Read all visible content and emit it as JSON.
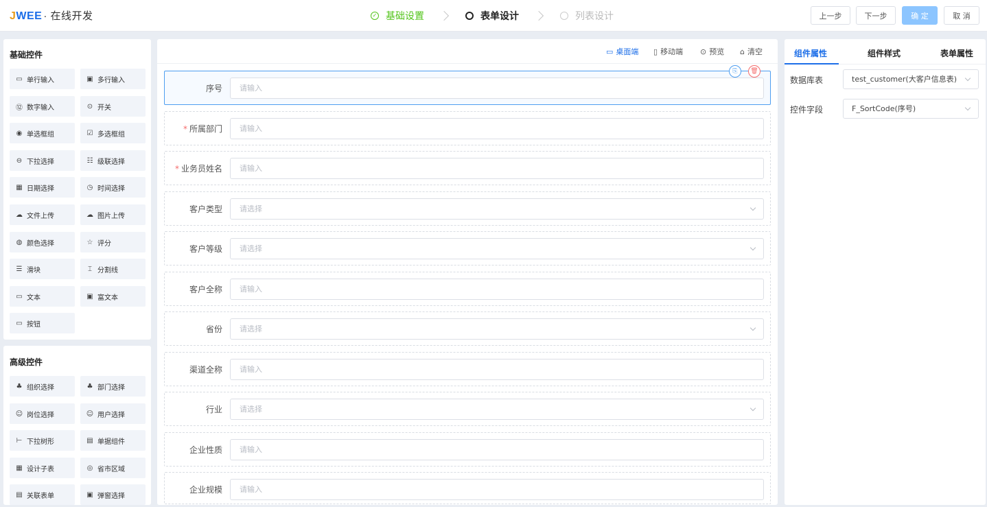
{
  "header": {
    "logo_j": "J",
    "logo_wee": "WEE",
    "logo_sub": "· 在线开发",
    "steps": [
      {
        "label": "基础设置",
        "state": "done"
      },
      {
        "label": "表单设计",
        "state": "active"
      },
      {
        "label": "列表设计",
        "state": "todo"
      }
    ],
    "buttons": {
      "prev": "上一步",
      "next": "下一步",
      "confirm": "确 定",
      "cancel": "取 消"
    }
  },
  "basic": {
    "title": "基础控件",
    "items": [
      {
        "label": "单行输入",
        "icon": "input-icon"
      },
      {
        "label": "多行输入",
        "icon": "textarea-icon"
      },
      {
        "label": "数字输入",
        "icon": "number-icon"
      },
      {
        "label": "开关",
        "icon": "switch-icon"
      },
      {
        "label": "单选框组",
        "icon": "radio-icon"
      },
      {
        "label": "多选框组",
        "icon": "checkbox-icon"
      },
      {
        "label": "下拉选择",
        "icon": "select-icon"
      },
      {
        "label": "级联选择",
        "icon": "cascader-icon"
      },
      {
        "label": "日期选择",
        "icon": "calendar-icon"
      },
      {
        "label": "时间选择",
        "icon": "clock-icon"
      },
      {
        "label": "文件上传",
        "icon": "upload-icon"
      },
      {
        "label": "图片上传",
        "icon": "image-upload-icon"
      },
      {
        "label": "颜色选择",
        "icon": "palette-icon"
      },
      {
        "label": "评分",
        "icon": "star-icon"
      },
      {
        "label": "滑块",
        "icon": "slider-icon"
      },
      {
        "label": "分割线",
        "icon": "divider-icon"
      },
      {
        "label": "文本",
        "icon": "text-icon"
      },
      {
        "label": "富文本",
        "icon": "rich-text-icon"
      },
      {
        "label": "按钮",
        "icon": "button-icon"
      }
    ]
  },
  "advanced": {
    "title": "高级控件",
    "items": [
      {
        "label": "组织选择",
        "icon": "org-icon"
      },
      {
        "label": "部门选择",
        "icon": "dept-icon"
      },
      {
        "label": "岗位选择",
        "icon": "position-icon"
      },
      {
        "label": "用户选择",
        "icon": "user-icon"
      },
      {
        "label": "下拉树形",
        "icon": "tree-icon"
      },
      {
        "label": "单据组件",
        "icon": "bill-icon"
      },
      {
        "label": "设计子表",
        "icon": "table-icon"
      },
      {
        "label": "省市区域",
        "icon": "region-icon"
      },
      {
        "label": "关联表单",
        "icon": "link-form-icon"
      },
      {
        "label": "弹窗选择",
        "icon": "popup-icon"
      }
    ]
  },
  "toolbar": {
    "desktop": "桌面端",
    "mobile": "移动端",
    "preview": "预览",
    "clear": "清空"
  },
  "form": {
    "rows": [
      {
        "label": "序号",
        "required": false,
        "type": "input",
        "placeholder": "请输入"
      },
      {
        "label": "所属部门",
        "required": true,
        "type": "input",
        "placeholder": "请输入"
      },
      {
        "label": "业务员姓名",
        "required": true,
        "type": "input",
        "placeholder": "请输入"
      },
      {
        "label": "客户类型",
        "required": false,
        "type": "select",
        "placeholder": "请选择"
      },
      {
        "label": "客户等级",
        "required": false,
        "type": "select",
        "placeholder": "请选择"
      },
      {
        "label": "客户全称",
        "required": false,
        "type": "input",
        "placeholder": "请输入"
      },
      {
        "label": "省份",
        "required": false,
        "type": "select",
        "placeholder": "请选择"
      },
      {
        "label": "渠道全称",
        "required": false,
        "type": "input",
        "placeholder": "请输入"
      },
      {
        "label": "行业",
        "required": false,
        "type": "select",
        "placeholder": "请选择"
      },
      {
        "label": "企业性质",
        "required": false,
        "type": "input",
        "placeholder": "请输入"
      },
      {
        "label": "企业规模",
        "required": false,
        "type": "input",
        "placeholder": "请输入"
      }
    ]
  },
  "props": {
    "tabs": [
      "组件属性",
      "组件样式",
      "表单属性"
    ],
    "fields": [
      {
        "label": "数据库表",
        "value": "test_customer(大客户信息表)"
      },
      {
        "label": "控件字段",
        "value": "F_SortCode(序号)"
      }
    ]
  },
  "colors": {
    "primary": "#1c6ee8",
    "success": "#52c41a",
    "danger": "#f56c6c",
    "widget_bg": "#f1f4f9"
  }
}
